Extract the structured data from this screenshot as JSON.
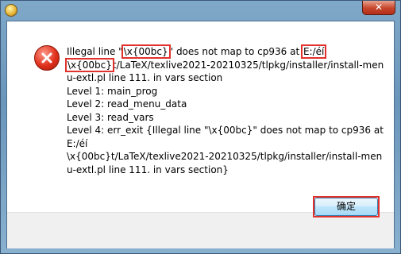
{
  "dialog": {
    "close_symbol": "✕",
    "message_lines": [
      [
        {
          "t": "Illegal line \""
        },
        {
          "t": "\\x{00bc}",
          "hl": true
        },
        {
          "t": "\" does not map to cp936 at "
        },
        {
          "t": "E:/éí",
          "hl": true
        }
      ],
      [
        {
          "t": "\\x{00bc}",
          "hl": true
        },
        {
          "t": "t/LaTeX/texlive2021-20210325/tlpkg/installer/install-men"
        }
      ],
      [
        {
          "t": "u-extl.pl line 111. in vars section"
        }
      ],
      [
        {
          "t": "Level 1: main_prog"
        }
      ],
      [
        {
          "t": "Level 2: read_menu_data"
        }
      ],
      [
        {
          "t": "Level 3: read_vars"
        }
      ],
      [
        {
          "t": "Level 4: err_exit {Illegal line \"\\x{00bc}\" does not map to cp936 at"
        }
      ],
      [
        {
          "t": "E:/éí"
        }
      ],
      [
        {
          "t": "\\x{00bc}t/LaTeX/texlive2021-20210325/tlpkg/installer/install-men"
        }
      ],
      [
        {
          "t": "u-extl.pl line 111. in vars section}"
        }
      ]
    ],
    "ok_label": "确定"
  },
  "colors": {
    "highlight": "#e0312c",
    "error_icon": "#e0311c",
    "footer_bg": "#f0f0f0"
  },
  "icons": {
    "app": "app-icon",
    "error": "error-icon",
    "close": "close-icon"
  }
}
